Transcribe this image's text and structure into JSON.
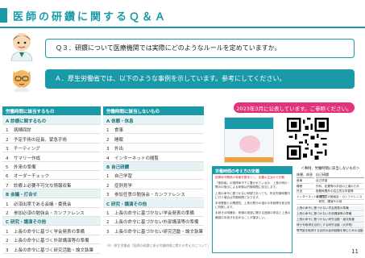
{
  "title": "医師の研鑽に関するＱ＆Ａ",
  "question": "Ｑ３．研鑽について医療機関では実際にどのようなルールを定めていますか。",
  "answer": "Ａ．厚生労働省では、以下のような事例を示しています。参考にしてください。",
  "table": {
    "col1_header": "労働時間に該当するもの",
    "col2_header": "労働時間に該当しないもの",
    "col1": [
      {
        "type": "cat",
        "num": "",
        "label": "A 診療に関するもの"
      },
      {
        "type": "item",
        "num": "1",
        "label": "病棟回診"
      },
      {
        "type": "item",
        "num": "2",
        "label": "予定手術の延長、緊急手術"
      },
      {
        "type": "item",
        "num": "3",
        "label": "チーティング"
      },
      {
        "type": "item",
        "num": "4",
        "label": "サマリー作成"
      },
      {
        "type": "item",
        "num": "5",
        "label": "外来の準備"
      },
      {
        "type": "item",
        "num": "6",
        "label": "オーダーチェック"
      },
      {
        "type": "item",
        "num": "7",
        "label": "診療上必要不可欠な情報収集"
      },
      {
        "type": "cat",
        "num": "",
        "label": "B 会議・打合せ"
      },
      {
        "type": "item",
        "num": "1",
        "label": "必須出席である会議・委員会"
      },
      {
        "type": "item",
        "num": "2",
        "label": "参加必須の勉強会・カンファレンス"
      },
      {
        "type": "cat",
        "num": "",
        "label": "C 研究・講演その他"
      },
      {
        "type": "item",
        "num": "1",
        "label": "上長の命令に基づく学会発表の準備"
      },
      {
        "type": "item",
        "num": "2",
        "label": "上長の命令に基づく外部講演等の準備"
      },
      {
        "type": "item",
        "num": "3",
        "label": "上長の命令に基づく研究活動・論文執筆"
      }
    ],
    "col2": [
      {
        "type": "cat",
        "num": "",
        "label": "A 休憩・休息"
      },
      {
        "type": "item",
        "num": "1",
        "label": "食事"
      },
      {
        "type": "item",
        "num": "2",
        "label": "睡眠"
      },
      {
        "type": "item",
        "num": "3",
        "label": "外出"
      },
      {
        "type": "item",
        "num": "4",
        "label": "インターネットの閲覧"
      },
      {
        "type": "cat",
        "num": "",
        "label": "B 自己研鑽"
      },
      {
        "type": "item",
        "num": "1",
        "label": "自己学習"
      },
      {
        "type": "item",
        "num": "2",
        "label": "症例見学"
      },
      {
        "type": "item",
        "num": "3",
        "label": "参加任意の勉強会・カンファレンス"
      },
      {
        "type": "cat",
        "num": "",
        "label": "C 研究・講演その他"
      },
      {
        "type": "item",
        "num": "1",
        "label": "上長の命令に基づかない学会発表の準備"
      },
      {
        "type": "item",
        "num": "2",
        "label": "上長の命令に基づかない外部講演等の準備"
      },
      {
        "type": "item",
        "num": "3",
        "label": "上長の命令に基づかない研究活動・論文執筆"
      }
    ],
    "footnote": "（※）厚生労働省「医師の研鑽に係る労働時間に関する考え方について」"
  },
  "pub_banner": "2023年3月に公表しています。ご参照ください。",
  "guide": {
    "title": "労働時間の考え方の定義",
    "lead": "指揮命令関係の有無を基本とし、定義の主旨から判断",
    "paragraphs": [
      "「使用者」の指揮命令下に置かれているか、上長の明示・黙示の指示による研鑽は労働時間に該当します。",
      "上長の命令に基づかない研鑽であっても、所定労働時間内に行う場合は労働時間となります。",
      "本来業務との関連性、上長の黙示の指示の有無等を総合的に判断します。",
      "手続きの明確化：研鑽の実施に関する医師の申告と上長の確認の手続きを定めることが望ましい。"
    ]
  },
  "examples": {
    "caption": "＜事例、労働時間に該当しないもの＞",
    "head1": "休憩、休息",
    "head2": "自己研鑽",
    "rows": [
      {
        "c1": "食事",
        "c2": "自己学習"
      },
      {
        "c1": "睡眠",
        "c2": "外科、処置等の手技の上達のため"
      },
      {
        "c1": "外出",
        "c2": "勤務時間外の自主的な学習等"
      },
      {
        "c1": "インターネットの閲覧",
        "c2": "参加任意の勉強会・カンファレンス"
      }
    ],
    "sub_caption": "研究、講演その他",
    "full_rows": [
      "上長の命令に基づかない学会発表の準備",
      "上長の命令に基づかない外部講演等の準備",
      "上長の命令に基づかない研究活動・論文執筆",
      "博士号取得を目的とする研究活動（大学院）",
      "専門医を取得する目的の症例経験を積むための活動"
    ]
  },
  "page_number": "11",
  "colors": {
    "accent": "#1a9aa8",
    "banner": "#e2337b"
  }
}
